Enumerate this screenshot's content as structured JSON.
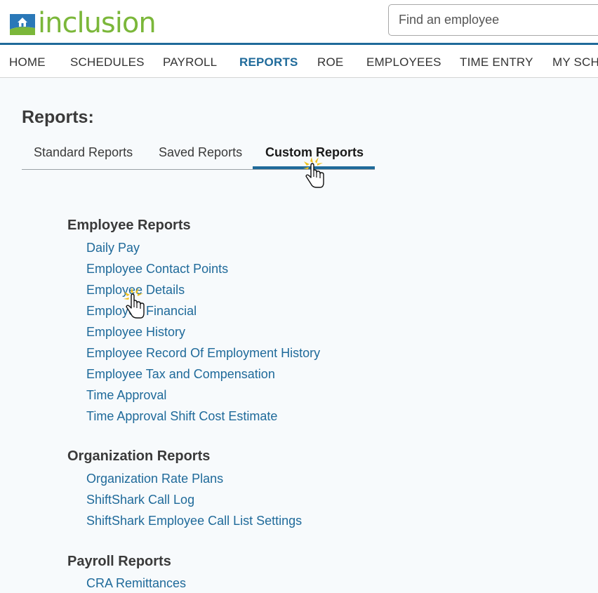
{
  "app": {
    "logo_text": "inclusion",
    "brand_color": "#7bb73a",
    "accent_color": "#1f6a9a"
  },
  "search": {
    "placeholder": "Find an employee",
    "value": ""
  },
  "nav": {
    "items": [
      {
        "label": "HOME"
      },
      {
        "label": "SCHEDULES"
      },
      {
        "label": "PAYROLL"
      },
      {
        "label": "REPORTS",
        "active": true
      },
      {
        "label": "ROE"
      },
      {
        "label": "EMPLOYEES"
      },
      {
        "label": "TIME ENTRY"
      },
      {
        "label": "MY SCH"
      }
    ]
  },
  "page": {
    "title": "Reports:",
    "tabs": [
      {
        "label": "Standard Reports"
      },
      {
        "label": "Saved Reports"
      },
      {
        "label": "Custom Reports",
        "active": true
      }
    ]
  },
  "sections": [
    {
      "heading": "Employee Reports",
      "links": [
        "Daily Pay",
        "Employee Contact Points",
        "Employee Details",
        "Employee Financial",
        "Employee History",
        "Employee Record Of Employment History",
        "Employee Tax and Compensation",
        "Time Approval",
        "Time Approval Shift Cost Estimate"
      ]
    },
    {
      "heading": "Organization Reports",
      "links": [
        "Organization Rate Plans",
        "ShiftShark Call Log",
        "ShiftShark Employee Call List Settings"
      ]
    },
    {
      "heading": "Payroll Reports",
      "links": [
        "CRA Remittances"
      ]
    }
  ],
  "icons": {
    "logo": "house-logo-icon",
    "cursor": "hand-pointer-icon"
  }
}
